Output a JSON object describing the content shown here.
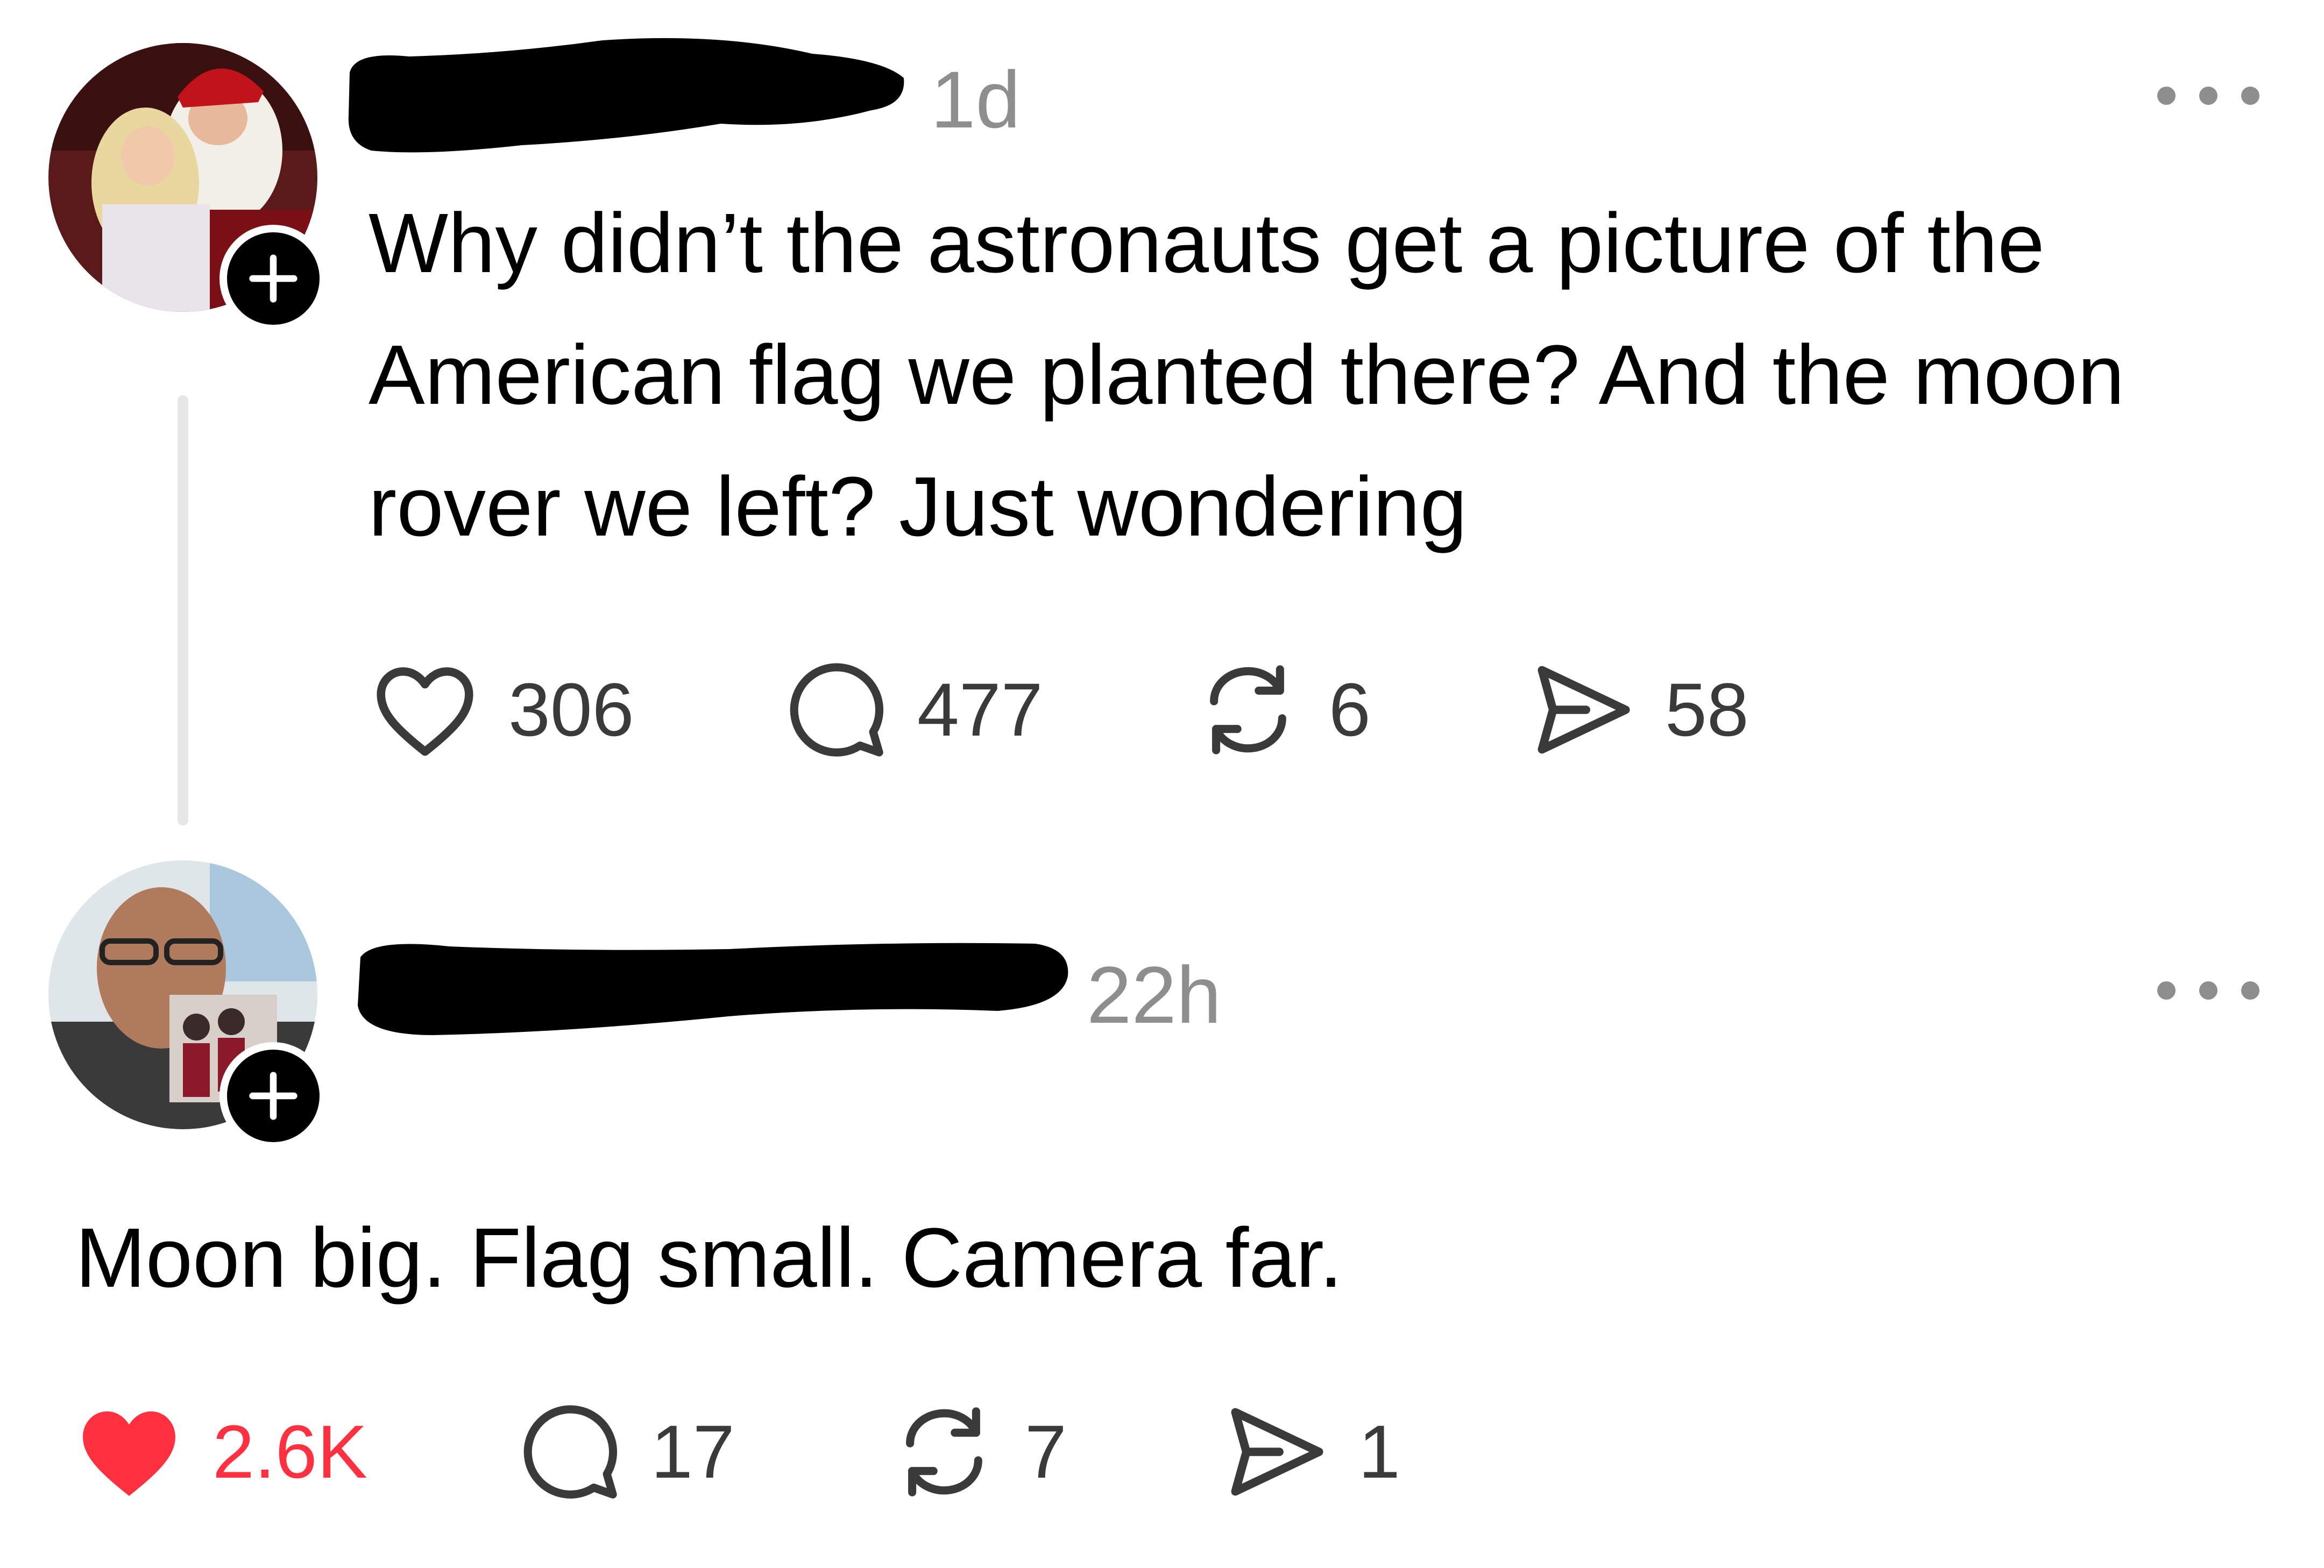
{
  "post": {
    "timestamp": "1d",
    "text": "Why didn’t the astronauts get a picture of the American flag we planted there? And the moon rover we left? Just wondering",
    "actions": {
      "likes": "306",
      "comments": "477",
      "reposts": "6",
      "shares": "58"
    }
  },
  "reply": {
    "timestamp": "22h",
    "text": "Moon big. Flag small. Camera far.",
    "actions": {
      "likes": "2.6K",
      "comments": "17",
      "reposts": "7",
      "shares": "1"
    }
  },
  "icons": {
    "like": "heart-icon",
    "comment": "speech-bubble-icon",
    "repost": "repost-icon",
    "share": "send-icon",
    "more": "more-horizontal-icon",
    "follow": "plus-icon"
  },
  "colors": {
    "liked": "#ff3040",
    "muted": "#8e8e8e",
    "icon": "#3a3a3a"
  }
}
